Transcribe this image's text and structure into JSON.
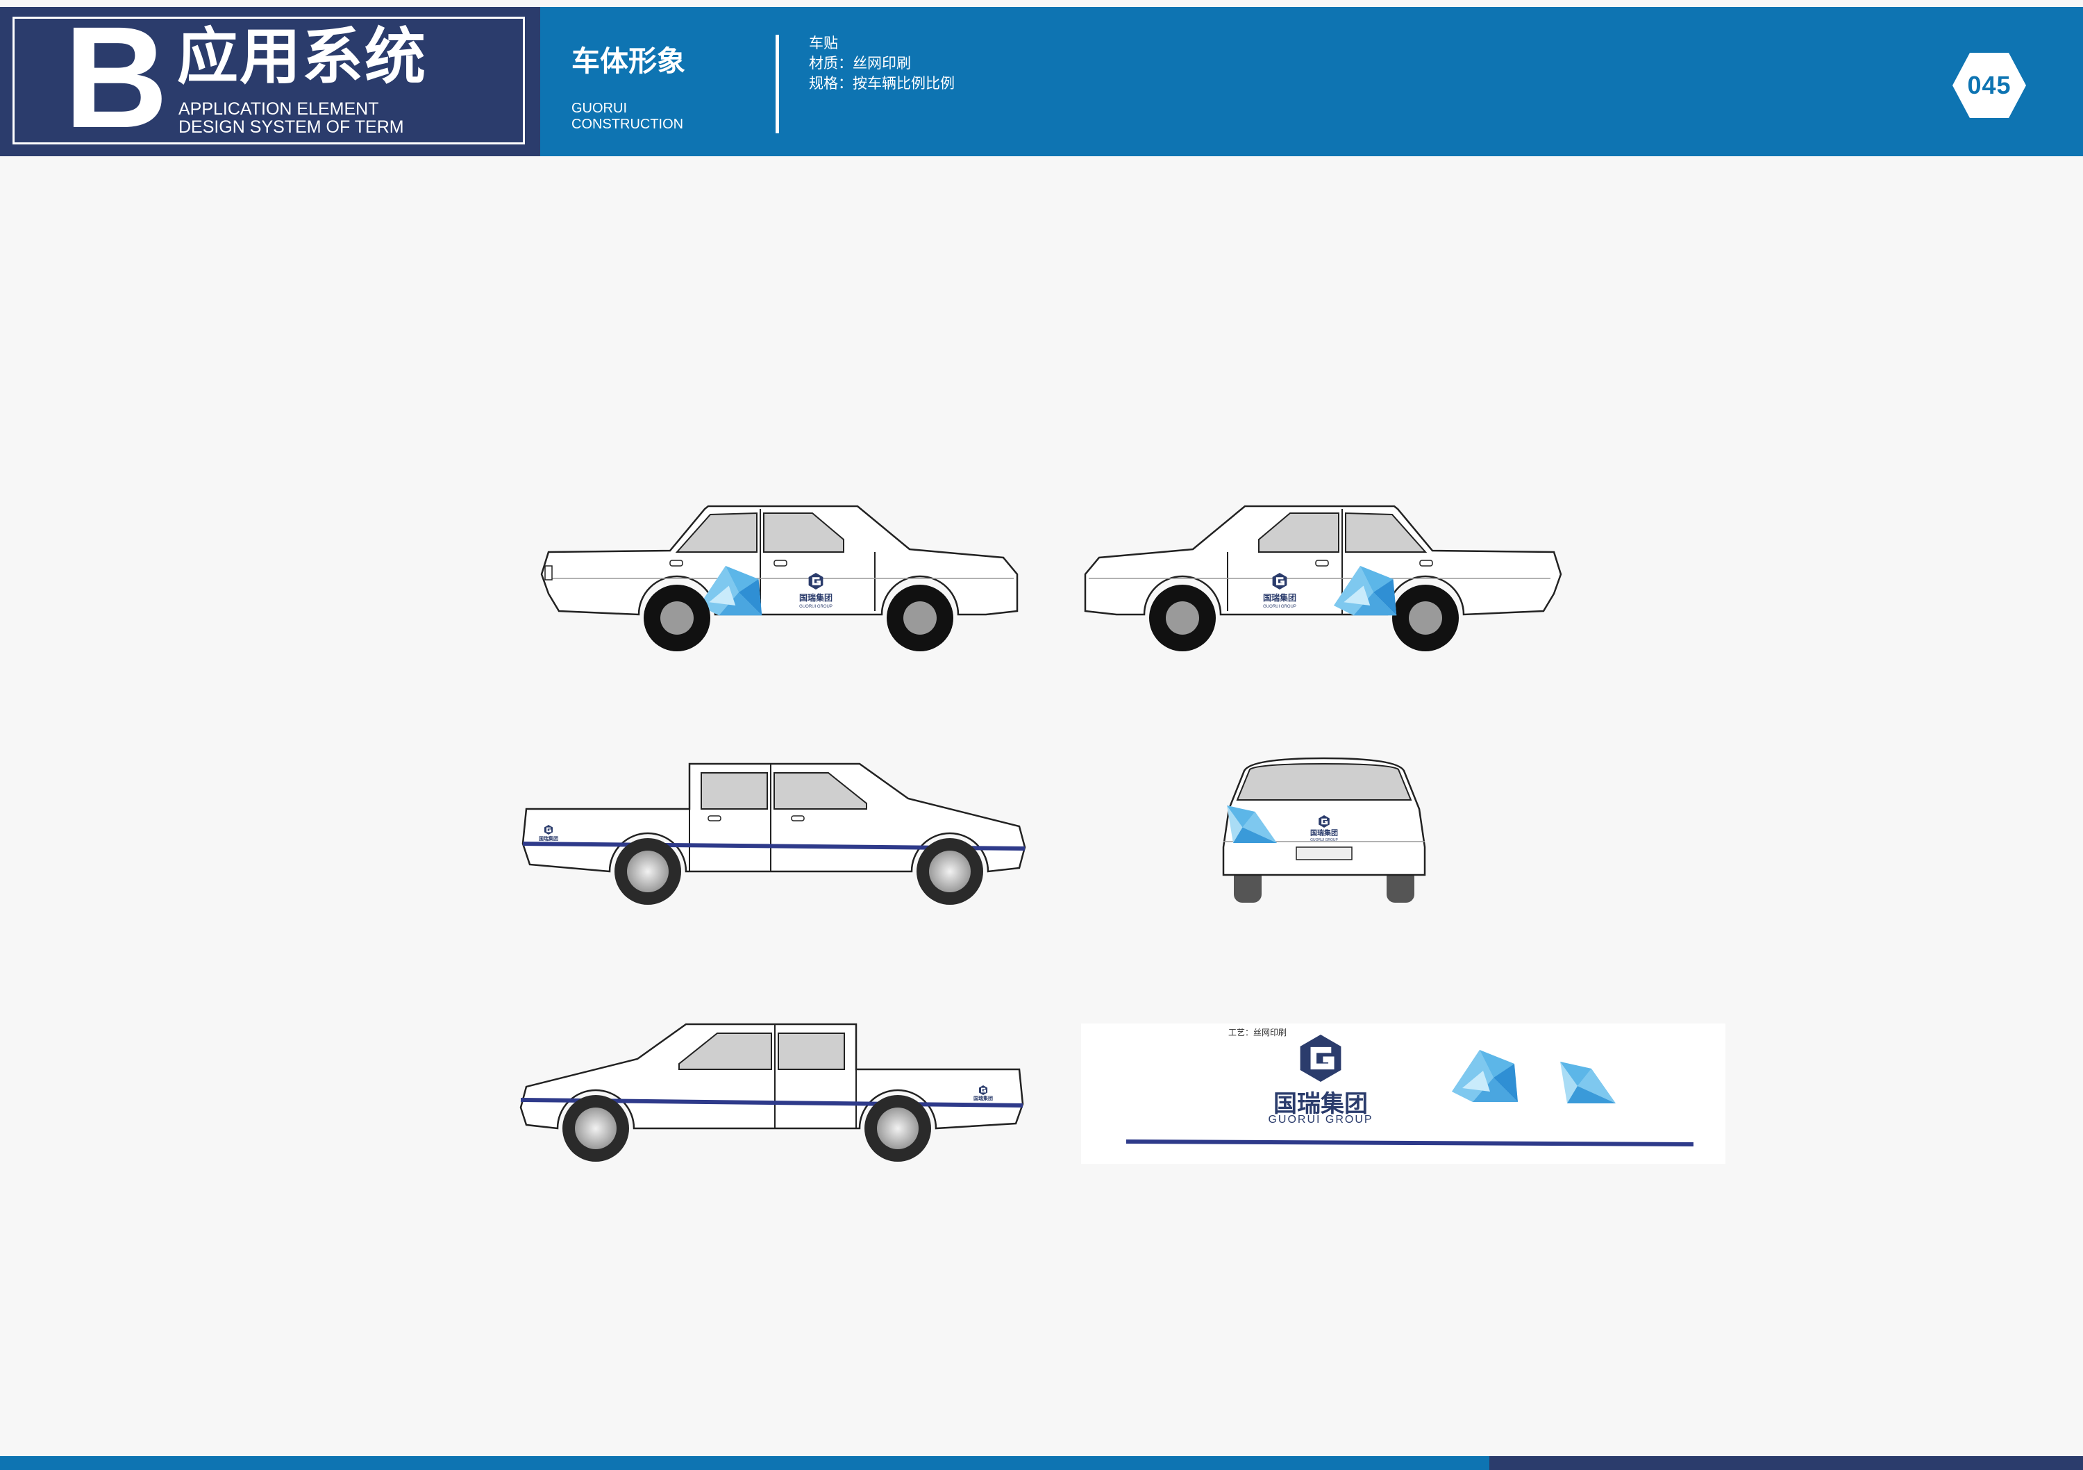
{
  "header": {
    "letter": "B",
    "title": "应用系统",
    "subtitle_line1": "APPLICATION ELEMENT",
    "subtitle_line2": "DESIGN SYSTEM OF TERM",
    "section_title": "车体形象",
    "section_sub_line1": "GUORUI",
    "section_sub_line2": "CONSTRUCTION",
    "spec_line1": "车贴",
    "spec_line2": "材质：丝网印刷",
    "spec_line3": "规格：按车辆比例比例",
    "page_number": "045"
  },
  "brand": {
    "logo_cn": "国瑞集团",
    "logo_en": "GUORUI GROUP",
    "process_note": "工艺：丝网印刷",
    "colors": {
      "primary_blue": "#0e74b2",
      "navy": "#2b3c6c",
      "stripe_navy": "#2e3a8a",
      "facet_light": "#a9dcf5",
      "facet_mid": "#5cb6e8",
      "facet_dark": "#2f8fd4"
    }
  },
  "icons": [
    "guorui-logo-icon",
    "crystal-facet-icon"
  ]
}
